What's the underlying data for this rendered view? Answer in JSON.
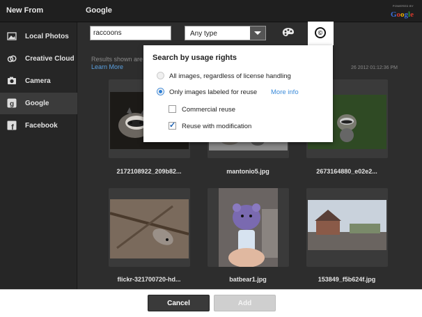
{
  "header": {
    "title": "New From",
    "content_title": "Google",
    "powered_by": "POWERED BY",
    "google_logo": "Google"
  },
  "sidebar": {
    "items": [
      {
        "label": "Local Photos",
        "icon": "image-icon",
        "active": false
      },
      {
        "label": "Creative Cloud",
        "icon": "creative-cloud-icon",
        "active": false
      },
      {
        "label": "Camera",
        "icon": "camera-icon",
        "active": false
      },
      {
        "label": "Google",
        "icon": "google-icon",
        "active": true
      },
      {
        "label": "Facebook",
        "icon": "facebook-icon",
        "active": false
      }
    ]
  },
  "search": {
    "value": "raccoons",
    "type_selected": "Any type",
    "palette_icon": "palette-icon",
    "cc_icon": "creative-commons-icon",
    "cc_symbol": "©"
  },
  "results": {
    "note": "Results shown are",
    "learn_more": "Learn More",
    "date": "26 2012 01:12:36 PM"
  },
  "tiles": [
    {
      "caption": "2172108922_209b82..."
    },
    {
      "caption": "mantonio5.jpg"
    },
    {
      "caption": "2673164880_e02e2..."
    },
    {
      "caption": "flickr-321700720-hd..."
    },
    {
      "caption": "batbear1.jpg"
    },
    {
      "caption": "153849_f5b624f.jpg"
    }
  ],
  "usage_rights": {
    "title": "Search by usage rights",
    "option_all": "All images, regardless of license handling",
    "option_labeled": "Only images labeled for reuse",
    "more_info": "More info",
    "commercial": "Commercial reuse",
    "modification": "Reuse with modification",
    "selected": "labeled",
    "commercial_checked": false,
    "modification_checked": true
  },
  "footer": {
    "cancel": "Cancel",
    "add": "Add"
  },
  "colors": {
    "accent": "#2e7fd6",
    "link": "#5aa0e0",
    "dark_bg": "#2d2d2d"
  }
}
